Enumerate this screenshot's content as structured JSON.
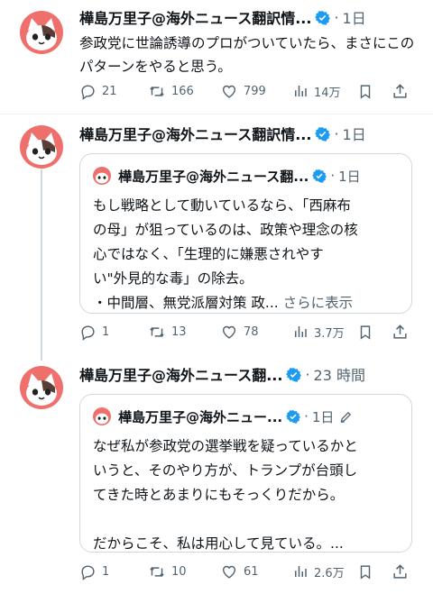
{
  "tweets": [
    {
      "author": "樺島万里子@海外ニュース翻訳情...",
      "time": "1日",
      "text": "参政党に世論誘導のプロがついていたら、まさにこのパターンをやると思う。",
      "replies": "21",
      "retweets": "166",
      "likes": "799",
      "views": "14万"
    },
    {
      "author": "樺島万里子@海外ニュース翻訳情...",
      "time": "1日",
      "quote": {
        "author": "樺島万里子@海外ニュース翻...",
        "time": "1日",
        "lines": [
          "もし戦略として動いているなら、「西麻布",
          "の母」が狙っているのは、政策や理念の核",
          "心ではなく、「生理的に嫌悪されやす",
          "い\"外見的な毒」の除去。",
          "・中間層、無党派層対策 政..."
        ],
        "show_more": "さらに表示"
      },
      "replies": "1",
      "retweets": "13",
      "likes": "78",
      "views": "3.7万"
    },
    {
      "author": "樺島万里子@海外ニュース翻...",
      "time": "23 時間",
      "quote": {
        "author": "樺島万里子@海外ニュー...",
        "time": "1日",
        "lines": [
          "なぜ私が参政党の選挙戦を疑っているかと",
          "いうと、そのやり方が、トランプが台頭し",
          "てきた時とあまりにもそっくりだから。",
          "",
          "だからこそ、私は用心して見ている。..."
        ]
      },
      "replies": "1",
      "retweets": "10",
      "likes": "61",
      "views": "2.6万"
    }
  ],
  "icons": {
    "reply": "reply-icon",
    "retweet": "retweet-icon",
    "like": "heart-icon",
    "views": "views-icon",
    "bookmark": "bookmark-icon",
    "share": "share-icon",
    "verified": "verified-badge-icon",
    "more": "more-icon",
    "edited": "edited-pencil-icon"
  },
  "colors": {
    "verified": "#1d9bf0",
    "avatar_bg": "#ef6f6c",
    "muted": "#536471"
  }
}
